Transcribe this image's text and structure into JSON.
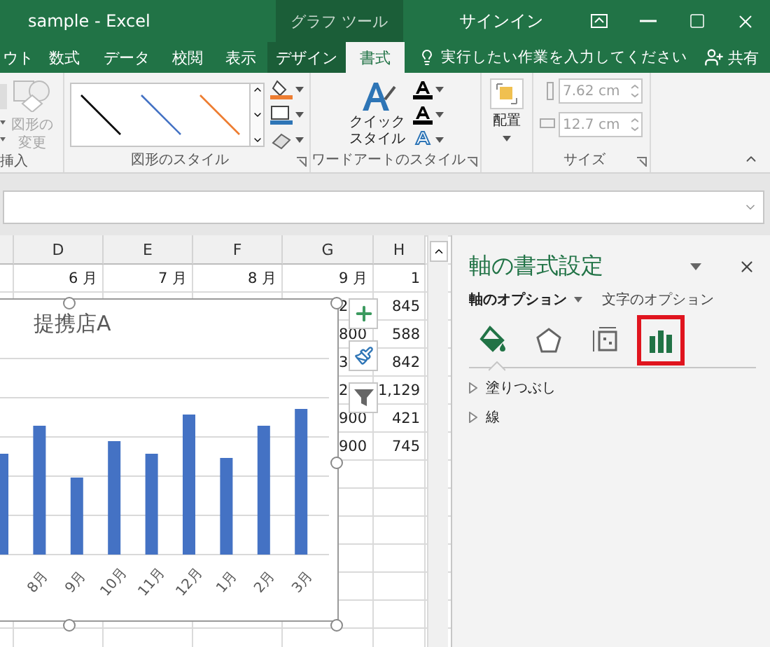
{
  "window": {
    "title": "sample  -  Excel",
    "context_tab": "グラフ ツール",
    "sign_in": "サインイン"
  },
  "ribbon_tabs": [
    {
      "label": "ウト",
      "selected": false,
      "kind": "main"
    },
    {
      "label": "数式",
      "selected": false,
      "kind": "main"
    },
    {
      "label": "データ",
      "selected": false,
      "kind": "main"
    },
    {
      "label": "校閲",
      "selected": false,
      "kind": "main"
    },
    {
      "label": "表示",
      "selected": false,
      "kind": "main"
    },
    {
      "label": "デザイン",
      "selected": false,
      "kind": "context"
    },
    {
      "label": "書式",
      "selected": true,
      "kind": "context"
    }
  ],
  "tell_me": "実行したい作業を入力してください",
  "share": "共有",
  "ribbon": {
    "change_shape": "図形の変更",
    "insert_group": "挿入",
    "shape_styles_group": "図形のスタイル",
    "quick_styles": "クイックスタイル",
    "wordart_group": "ワードアートのスタイル",
    "arrange": "配置",
    "size_fields": [
      {
        "value": "7.62 cm",
        "disabled": true
      },
      {
        "value": "12.7 cm",
        "disabled": true
      }
    ],
    "size_group": "サイズ"
  },
  "sheet": {
    "columns": [
      "",
      "D",
      "E",
      "F",
      "G",
      "H"
    ],
    "rows": [
      [
        "",
        "6 月",
        "7 月",
        "8 月",
        "9 月",
        "1"
      ],
      [
        "",
        "",
        "",
        "",
        "2",
        "845"
      ],
      [
        "",
        "",
        "",
        "",
        "800",
        "588"
      ],
      [
        "",
        "",
        "",
        "",
        "3",
        "842"
      ],
      [
        "",
        "",
        "",
        "",
        "2",
        "1,129"
      ],
      [
        "",
        "",
        "",
        "",
        "900",
        "421"
      ],
      [
        "",
        "",
        "",
        "",
        "900",
        "745"
      ]
    ]
  },
  "chart": {
    "title": "提携店A",
    "axis_labels": [
      "8月",
      "9月",
      "10月",
      "11月",
      "12月",
      "1月",
      "2月",
      "3月"
    ]
  },
  "pane": {
    "title": "軸の書式設定",
    "tabs": [
      {
        "label": "軸のオプション",
        "selected": true
      },
      {
        "label": "文字のオプション",
        "selected": false
      }
    ],
    "icon_tabs": [
      {
        "kind": "fill",
        "selected": true,
        "highlighted": false
      },
      {
        "kind": "effects",
        "selected": false,
        "highlighted": false
      },
      {
        "kind": "size",
        "selected": false,
        "highlighted": false
      },
      {
        "kind": "axis",
        "selected": false,
        "highlighted": true
      }
    ],
    "sections": [
      {
        "label": "塗りつぶし",
        "expanded": false
      },
      {
        "label": "線",
        "expanded": false
      }
    ]
  }
}
